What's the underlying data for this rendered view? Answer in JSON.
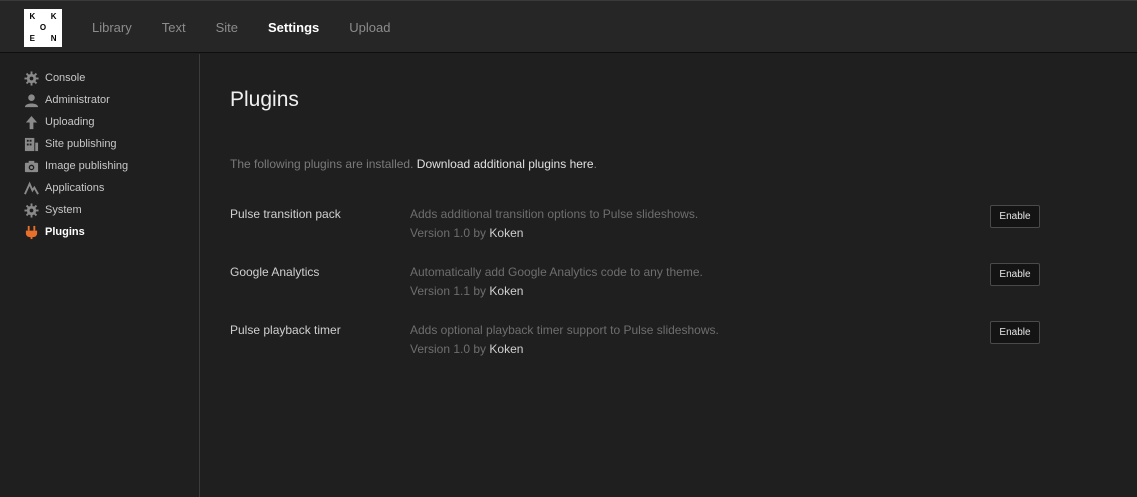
{
  "logo": {
    "letters": [
      "K",
      "",
      "K",
      "",
      "O",
      "",
      "E",
      "",
      "N"
    ]
  },
  "nav": {
    "items": [
      {
        "label": "Library",
        "active": false
      },
      {
        "label": "Text",
        "active": false
      },
      {
        "label": "Site",
        "active": false
      },
      {
        "label": "Settings",
        "active": true
      },
      {
        "label": "Upload",
        "active": false
      }
    ]
  },
  "sidebar": {
    "items": [
      {
        "label": "Console",
        "icon": "gear-icon",
        "active": false
      },
      {
        "label": "Administrator",
        "icon": "user-icon",
        "active": false
      },
      {
        "label": "Uploading",
        "icon": "arrow-up-icon",
        "active": false
      },
      {
        "label": "Site publishing",
        "icon": "site-icon",
        "active": false
      },
      {
        "label": "Image publishing",
        "icon": "camera-icon",
        "active": false
      },
      {
        "label": "Applications",
        "icon": "applications-icon",
        "active": false
      },
      {
        "label": "System",
        "icon": "gear-icon",
        "active": false
      },
      {
        "label": "Plugins",
        "icon": "plug-icon",
        "active": true
      }
    ]
  },
  "main": {
    "title": "Plugins",
    "intro_text": "The following plugins are installed.",
    "intro_link": "Download additional plugins here",
    "intro_suffix": ".",
    "plugins": [
      {
        "name": "Pulse transition pack",
        "description": "Adds additional transition options to Pulse slideshows.",
        "version_prefix": "Version 1.0 by",
        "author": "Koken",
        "button": "Enable"
      },
      {
        "name": "Google Analytics",
        "description": "Automatically add Google Analytics code to any theme.",
        "version_prefix": "Version 1.1 by",
        "author": "Koken",
        "button": "Enable"
      },
      {
        "name": "Pulse playback timer",
        "description": "Adds optional playback timer support to Pulse slideshows.",
        "version_prefix": "Version 1.0 by",
        "author": "Koken",
        "button": "Enable"
      }
    ]
  },
  "colors": {
    "accent": "#e8702a",
    "background": "#1f1f1f",
    "topbar": "#262626"
  }
}
